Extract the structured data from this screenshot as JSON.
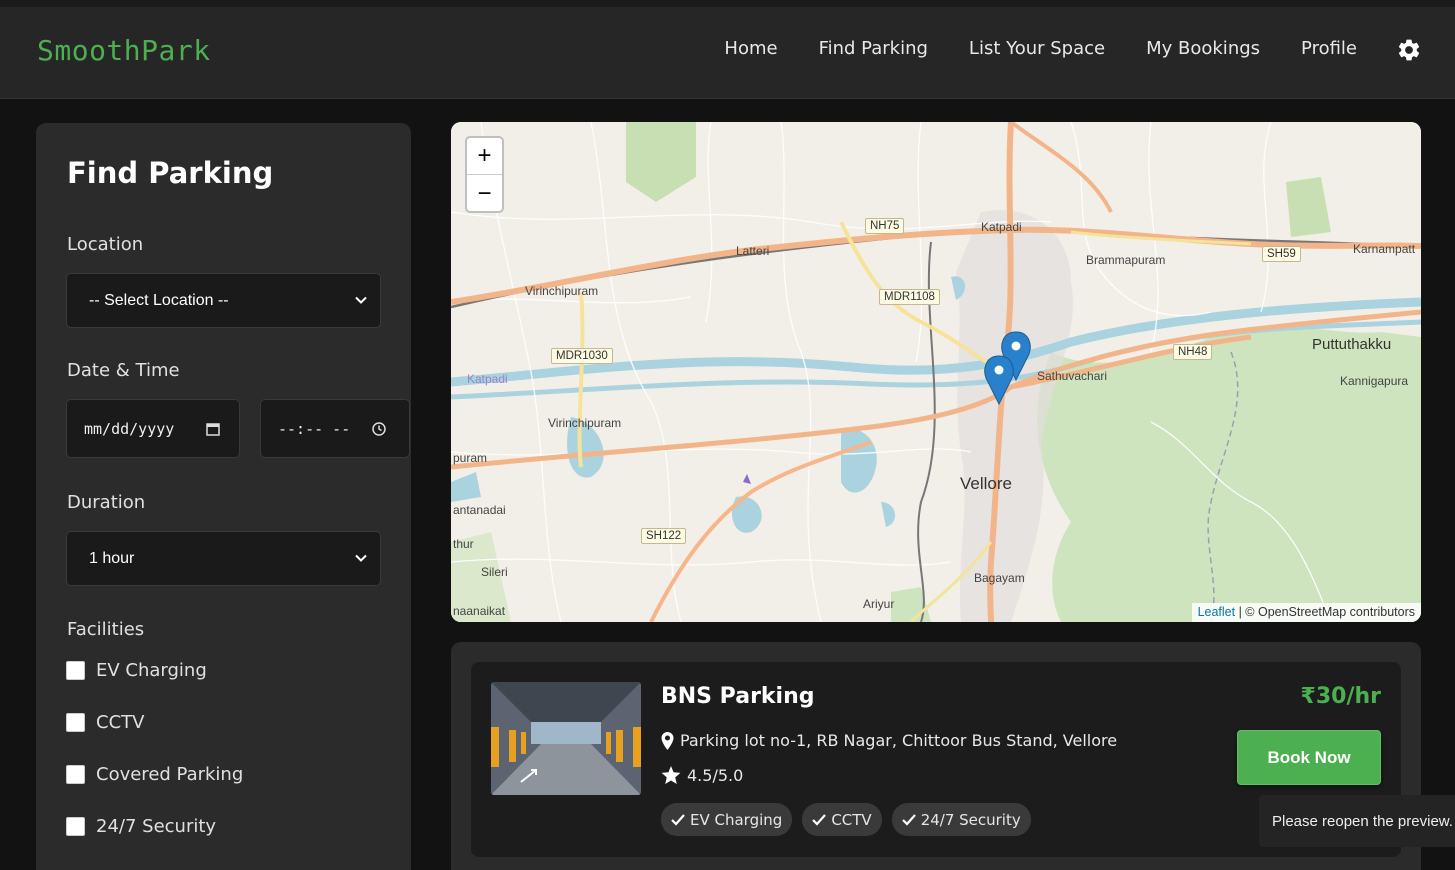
{
  "app": {
    "brand": "SmoothPark"
  },
  "nav": {
    "links": [
      "Home",
      "Find Parking",
      "List Your Space",
      "My Bookings",
      "Profile"
    ],
    "settings_icon": "gear-icon"
  },
  "sidebar": {
    "title": "Find Parking",
    "location": {
      "label": "Location",
      "value": "-- Select Location --"
    },
    "datetime": {
      "label": "Date & Time",
      "date_placeholder": "mm/dd/yyyy",
      "time_placeholder": "--:-- --"
    },
    "duration": {
      "label": "Duration",
      "value": "1 hour"
    },
    "facilities": {
      "label": "Facilities",
      "options": [
        {
          "label": "EV Charging",
          "checked": false
        },
        {
          "label": "CCTV",
          "checked": false
        },
        {
          "label": "Covered Parking",
          "checked": false
        },
        {
          "label": "24/7 Security",
          "checked": false
        }
      ]
    }
  },
  "map": {
    "zoom_in": "+",
    "zoom_out": "−",
    "attribution_link": "Leaflet",
    "attribution_text": " | © OpenStreetMap contributors",
    "places": [
      "Katpadi",
      "Latteri",
      "Brammapuram",
      "Karnampatt",
      "Virinchipuram",
      "Virinchipuram",
      "Sathuvachari",
      "Puttuthakku",
      "Kannigapura",
      "Katpadi",
      "Vellore",
      "Bagayam",
      "Ariyur",
      "Sileri",
      "naanaikat",
      "antanadai",
      "thur",
      "puram"
    ],
    "roads": [
      "NH75",
      "SH59",
      "MDR1108",
      "MDR1030",
      "NH48",
      "SH122"
    ],
    "marker_count": 2
  },
  "results": [
    {
      "name": "BNS Parking",
      "price": "₹30/hr",
      "address": "Parking lot no-1, RB Nagar, Chittoor Bus Stand, Vellore",
      "rating": "4.5/5.0",
      "features": [
        "EV Charging",
        "CCTV",
        "24/7 Security"
      ],
      "action": "Book Now"
    }
  ],
  "toast": "Please reopen the preview.",
  "colors": {
    "accent": "#4caf50",
    "background": "#121212",
    "panel": "#2b2b2b"
  }
}
